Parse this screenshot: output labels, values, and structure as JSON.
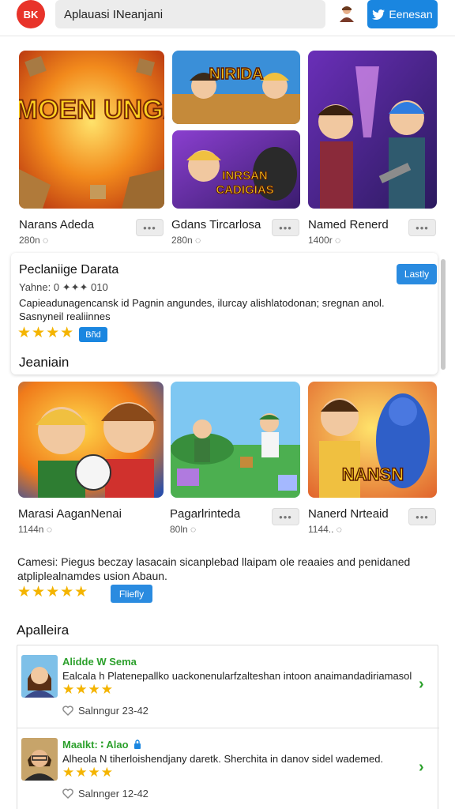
{
  "header": {
    "logo_text": "BK",
    "search_value": "Aplauasi INeanjani",
    "twitter_label": "Eenesan",
    "accent": "#1a86e0",
    "logo_color": "#e8332a"
  },
  "row1": [
    {
      "name": "Narans Adeda",
      "meta": "280n ◌",
      "art_title": "SLMOEN UNGAN"
    },
    {
      "name": "Gdans Tircarlosa",
      "meta": "280n ◌",
      "art_title_a": "NIRIDA",
      "art_title_b": "INRSAN CADIGIAS"
    },
    {
      "name": "Named Renerd",
      "meta": "1400r ◌"
    }
  ],
  "feature": {
    "title": "Peclaniige Darata",
    "subtitle": "Yahne: 0 ✦✦✦ 010",
    "description": "Capieadunagencansk id Pagnin angundes, ilurcay alishlatodonan; sregnan anol. Sasnyneil realiinnes",
    "stars": "★★★★",
    "badge": "Bñd",
    "button": "Lastly"
  },
  "section_jeaniain": "Jeaniain",
  "row2": [
    {
      "name": "Marasi AaganNenai",
      "meta": "1144n ◌"
    },
    {
      "name": "Pagarlrinteda",
      "meta": "80ln ◌"
    },
    {
      "name": "Nanerd Nrteaid",
      "meta": "1144.. ◌",
      "art_title": "NANSN"
    }
  ],
  "desc2": {
    "text": "Camesi: Piegus beczay lasacain sicanplebad llaipam ole reaaies and penidaned atpliplealnamdes usion Abaun.",
    "stars": "★★★★★",
    "button": "Fliefly"
  },
  "section_apalleira": "Apalleira",
  "reviews": [
    {
      "name": "Alidde W Sema",
      "text": "Ealcala h Platenepallko uackonenularfzalteshan intoon anaimandadiriamasol",
      "stars": "★★★★",
      "meta": "Salnngur 23-42"
    },
    {
      "name": "Maalkt: ∶ Alao",
      "text": "Alheola N tiherloishendjany daretk. Sherchita in danov sidel wademed.",
      "stars": "★★★★",
      "meta": "Salnnger 12-42"
    }
  ]
}
